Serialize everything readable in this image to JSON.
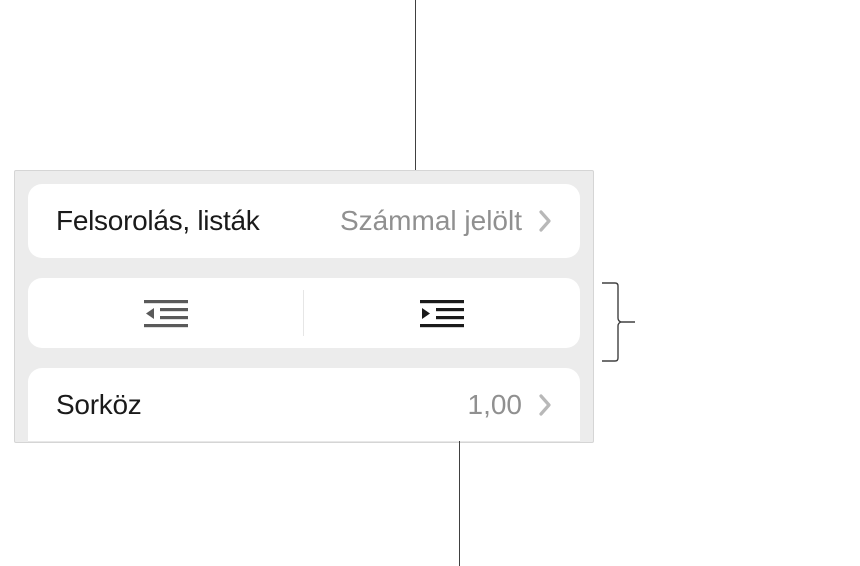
{
  "bullets": {
    "label": "Felsorolás, listák",
    "value": "Számmal jelölt"
  },
  "spacing": {
    "label": "Sorköz",
    "value": "1,00"
  },
  "icons": {
    "outdent": "outdent",
    "indent": "indent"
  }
}
